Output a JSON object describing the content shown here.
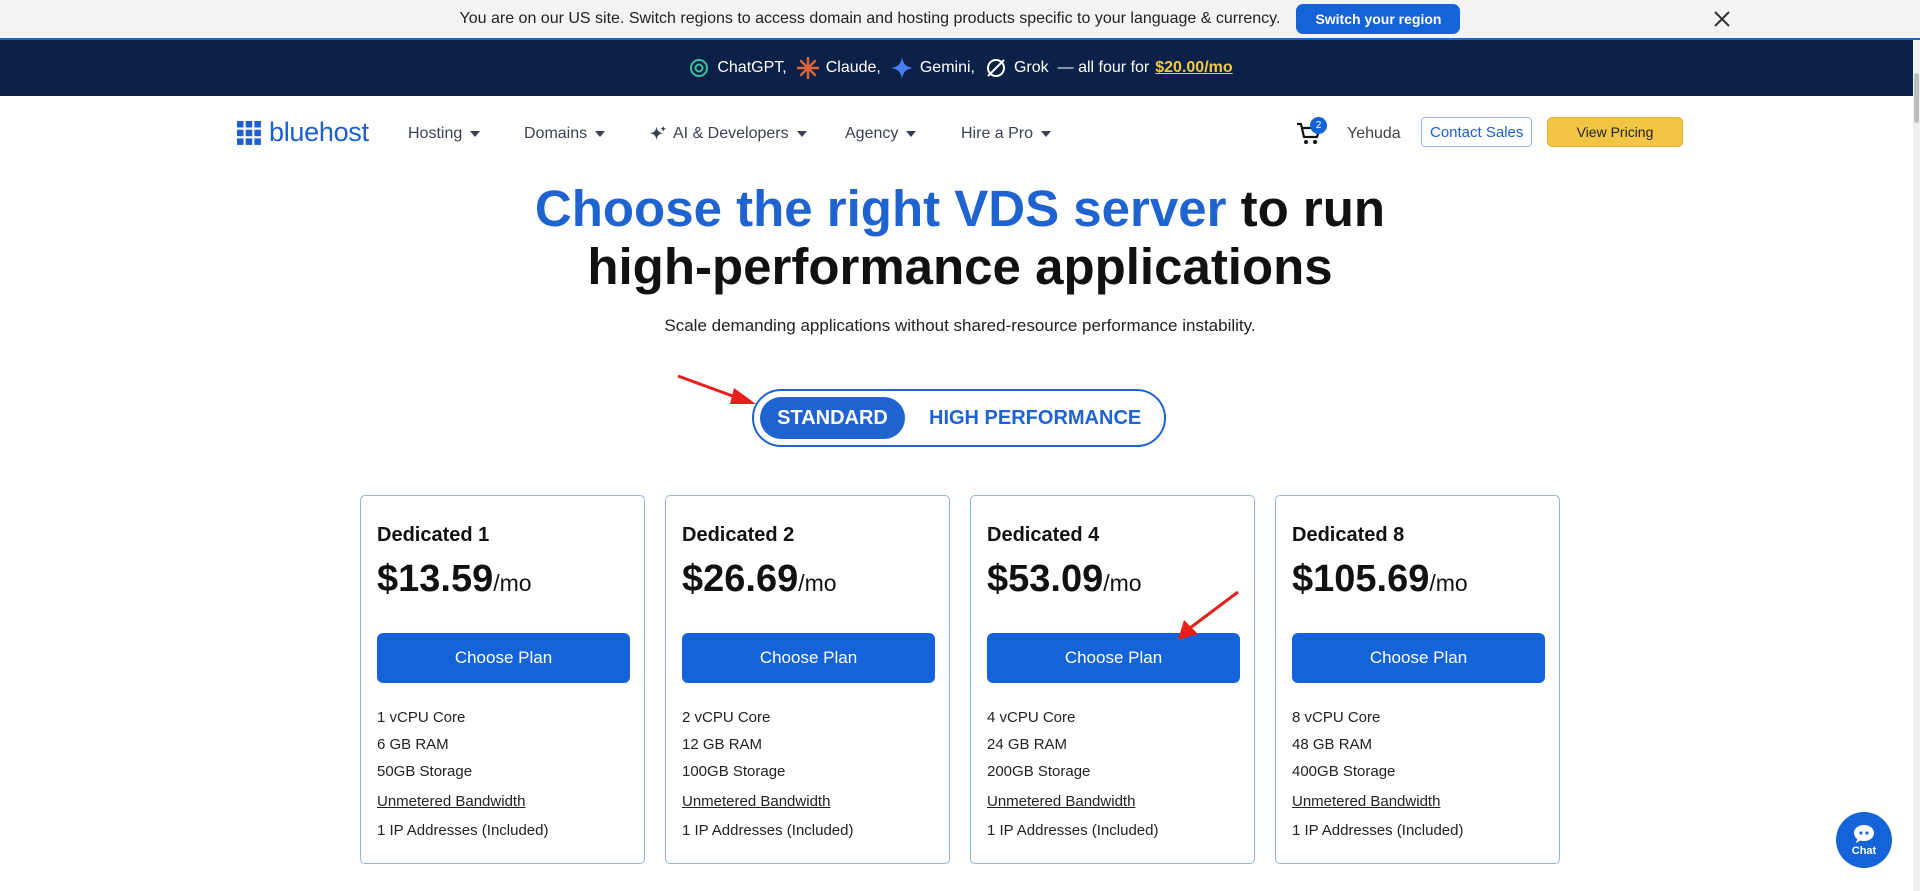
{
  "region_banner": {
    "message": "You are on our US site. Switch regions to access domain and hosting products specific to your language & currency.",
    "button_label": "Switch your region"
  },
  "promo": {
    "items": [
      "ChatGPT,",
      "Claude,",
      "Gemini,",
      "Grok"
    ],
    "tagline": "— all four for",
    "price": "$20.00/mo"
  },
  "nav": {
    "logo": "bluehost",
    "items": [
      "Hosting",
      "Domains",
      "AI & Developers",
      "Agency",
      "Hire a Pro"
    ],
    "cart_count": "2",
    "user": "Yehuda",
    "contact_label": "Contact Sales",
    "pricing_label": "View Pricing"
  },
  "hero": {
    "title_accent": "Choose the right VDS server",
    "title_rest_1": " to run",
    "title_line2": "high-performance applications",
    "subtitle": "Scale demanding applications without shared-resource performance instability."
  },
  "toggle": {
    "standard": "STANDARD",
    "high_performance": "HIGH PERFORMANCE",
    "selected": "STANDARD"
  },
  "plans": [
    {
      "name": "Dedicated 1",
      "price": "$13.59",
      "per": "/mo",
      "button": "Choose Plan",
      "features": [
        "1 vCPU Core",
        "6 GB RAM",
        "50GB Storage",
        "Unmetered Bandwidth",
        "1 IP Addresses (Included)"
      ]
    },
    {
      "name": "Dedicated 2",
      "price": "$26.69",
      "per": "/mo",
      "button": "Choose Plan",
      "features": [
        "2 vCPU Core",
        "12 GB RAM",
        "100GB Storage",
        "Unmetered Bandwidth",
        "1 IP Addresses (Included)"
      ]
    },
    {
      "name": "Dedicated 4",
      "price": "$53.09",
      "per": "/mo",
      "button": "Choose Plan",
      "features": [
        "4 vCPU Core",
        "24 GB RAM",
        "200GB Storage",
        "Unmetered Bandwidth",
        "1 IP Addresses (Included)"
      ]
    },
    {
      "name": "Dedicated 8",
      "price": "$105.69",
      "per": "/mo",
      "button": "Choose Plan",
      "features": [
        "8 vCPU Core",
        "48 GB RAM",
        "400GB Storage",
        "Unmetered Bandwidth",
        "1 IP Addresses (Included)"
      ]
    }
  ],
  "chat": {
    "label": "Chat"
  },
  "colors": {
    "brand_blue": "#1463d9",
    "navy": "#0b2147",
    "accent_yellow": "#f2c544",
    "annotation_red": "#e8201c"
  }
}
